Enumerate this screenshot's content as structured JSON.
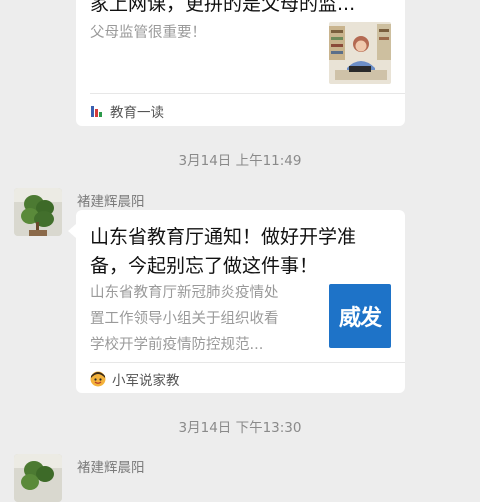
{
  "messages": [
    {
      "title_line": "家上网课，更拼的是父母的监...",
      "summary": "父母监管很重要！",
      "source": "教育一读"
    },
    {
      "timestamp": "3月14日 上午11:49",
      "sender": "褚建辉晨阳",
      "title_line1": "山东省教育厅通知！做好开学准",
      "title_line2": "备，今起别忘了做这件事！",
      "summary_line1": "山东省教育厅新冠肺炎疫情处",
      "summary_line2": "置工作领导小组关于组织收看",
      "summary_line3": "学校开学前疫情防控规范...",
      "thumb_text": "威发",
      "source": "小军说家教"
    },
    {
      "timestamp": "3月14日 下午13:30",
      "sender": "褚建辉晨阳"
    }
  ],
  "colors": {
    "background": "#ededed",
    "card": "#ffffff",
    "thumb_blue": "#1e73c8"
  },
  "icons": {
    "source_1": "book-stack-icon",
    "source_2": "cartoon-face-icon",
    "avatar": "plant-photo-avatar"
  }
}
